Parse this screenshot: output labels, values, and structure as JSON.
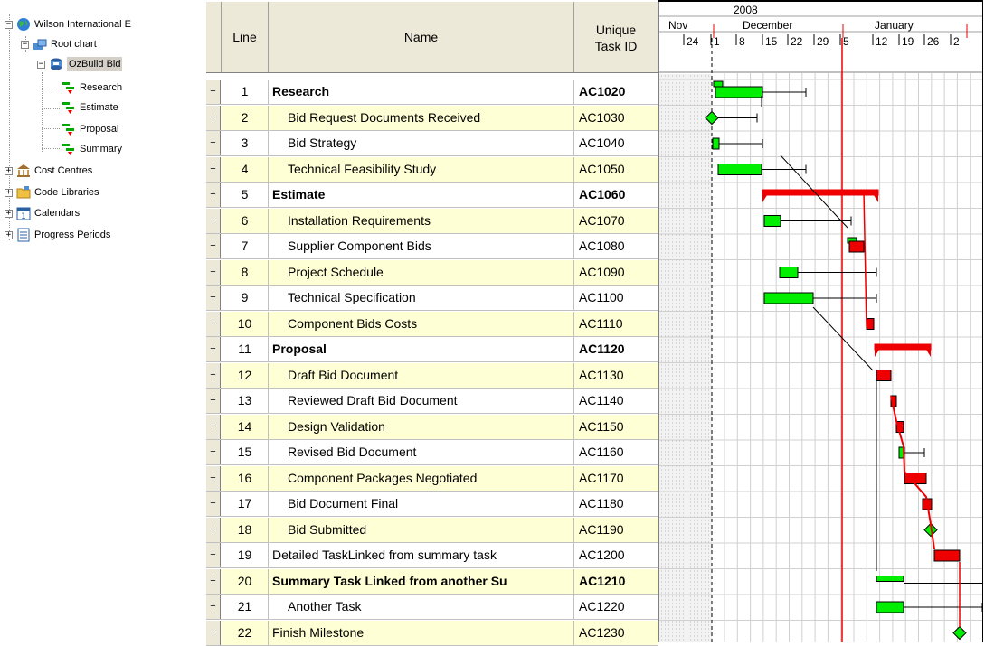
{
  "tree": {
    "root_label": "Wilson International E",
    "items": [
      {
        "label": "Root chart"
      },
      {
        "label": "OzBuild Bid"
      },
      {
        "label": "Research"
      },
      {
        "label": "Estimate"
      },
      {
        "label": "Proposal"
      },
      {
        "label": "Summary"
      },
      {
        "label": "Cost Centres"
      },
      {
        "label": "Code Libraries"
      },
      {
        "label": "Calendars"
      },
      {
        "label": "Progress Periods"
      }
    ]
  },
  "grid": {
    "headers": {
      "line": "Line",
      "name": "Name",
      "uid": "Unique Task ID"
    },
    "expand_symbol": "+",
    "rows": [
      {
        "line": "1",
        "name": "Research",
        "uid": "AC1020",
        "bold": true,
        "indent": false
      },
      {
        "line": "2",
        "name": "Bid Request Documents Received",
        "uid": "AC1030",
        "bold": false,
        "indent": true
      },
      {
        "line": "3",
        "name": "Bid Strategy",
        "uid": "AC1040",
        "bold": false,
        "indent": true
      },
      {
        "line": "4",
        "name": "Technical Feasibility Study",
        "uid": "AC1050",
        "bold": false,
        "indent": true
      },
      {
        "line": "5",
        "name": "Estimate",
        "uid": "AC1060",
        "bold": true,
        "indent": false
      },
      {
        "line": "6",
        "name": "Installation Requirements",
        "uid": "AC1070",
        "bold": false,
        "indent": true
      },
      {
        "line": "7",
        "name": "Supplier Component Bids",
        "uid": "AC1080",
        "bold": false,
        "indent": true
      },
      {
        "line": "8",
        "name": "Project Schedule",
        "uid": "AC1090",
        "bold": false,
        "indent": true
      },
      {
        "line": "9",
        "name": "Technical Specification",
        "uid": "AC1100",
        "bold": false,
        "indent": true
      },
      {
        "line": "10",
        "name": "Component Bids Costs",
        "uid": "AC1110",
        "bold": false,
        "indent": true
      },
      {
        "line": "11",
        "name": "Proposal",
        "uid": "AC1120",
        "bold": true,
        "indent": false
      },
      {
        "line": "12",
        "name": "Draft Bid Document",
        "uid": "AC1130",
        "bold": false,
        "indent": true
      },
      {
        "line": "13",
        "name": "Reviewed Draft Bid Document",
        "uid": "AC1140",
        "bold": false,
        "indent": true
      },
      {
        "line": "14",
        "name": "Design Validation",
        "uid": "AC1150",
        "bold": false,
        "indent": true
      },
      {
        "line": "15",
        "name": "Revised Bid Document",
        "uid": "AC1160",
        "bold": false,
        "indent": true
      },
      {
        "line": "16",
        "name": "Component Packages Negotiated",
        "uid": "AC1170",
        "bold": false,
        "indent": true
      },
      {
        "line": "17",
        "name": "Bid Document Final",
        "uid": "AC1180",
        "bold": false,
        "indent": true
      },
      {
        "line": "18",
        "name": "Bid Submitted",
        "uid": "AC1190",
        "bold": false,
        "indent": true
      },
      {
        "line": "19",
        "name": "Detailed TaskLinked from summary task",
        "uid": "AC1200",
        "bold": false,
        "indent": false
      },
      {
        "line": "20",
        "name": "Summary Task Linked from another Su",
        "uid": "AC1210",
        "bold": true,
        "indent": false
      },
      {
        "line": "21",
        "name": "Another Task",
        "uid": "AC1220",
        "bold": false,
        "indent": true
      },
      {
        "line": "22",
        "name": "Finish Milestone",
        "uid": "AC1230",
        "bold": false,
        "indent": false
      }
    ]
  },
  "gantt": {
    "year": "2008",
    "months": [
      "Nov",
      "December",
      "January"
    ],
    "days": [
      "24",
      "1",
      "8",
      "15",
      "22",
      "29",
      "5",
      "12",
      "19",
      "26",
      "2"
    ],
    "colors": {
      "normal": "#00ee00",
      "critical": "#ee0000",
      "today_line": "#ee0000",
      "progress": "#000000"
    }
  }
}
